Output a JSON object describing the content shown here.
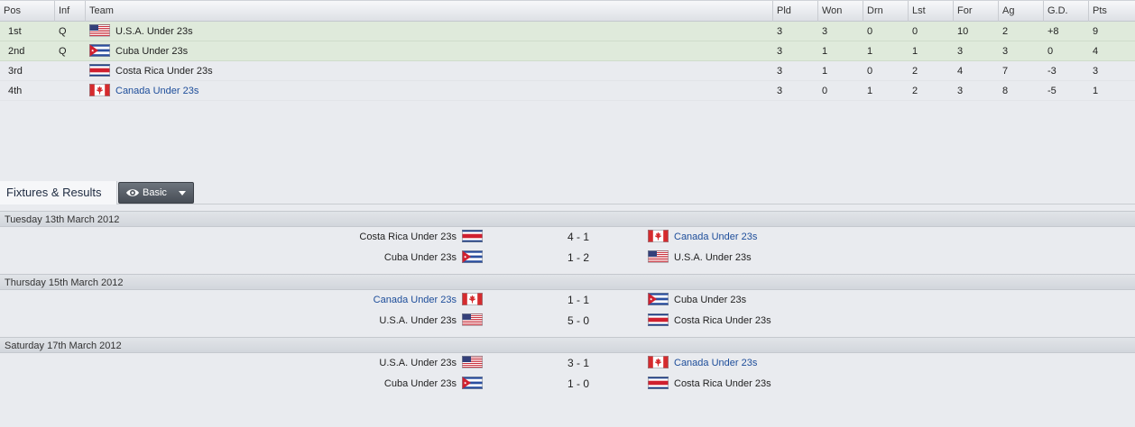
{
  "table": {
    "columns": [
      "Pos",
      "Inf",
      "Team",
      "Pld",
      "Won",
      "Drn",
      "Lst",
      "For",
      "Ag",
      "G.D.",
      "Pts"
    ],
    "rows": [
      {
        "pos": "1st",
        "inf": "Q",
        "flag": "usa-flag",
        "team": "U.S.A. Under 23s",
        "pld": "3",
        "won": "3",
        "drn": "0",
        "lst": "0",
        "for": "10",
        "ag": "2",
        "gd": "+8",
        "pts": "9",
        "qualified": true,
        "link": false
      },
      {
        "pos": "2nd",
        "inf": "Q",
        "flag": "cuba-flag",
        "team": "Cuba Under 23s",
        "pld": "3",
        "won": "1",
        "drn": "1",
        "lst": "1",
        "for": "3",
        "ag": "3",
        "gd": "0",
        "pts": "4",
        "qualified": true,
        "link": false
      },
      {
        "pos": "3rd",
        "inf": "",
        "flag": "costa-rica-flag",
        "team": "Costa Rica Under 23s",
        "pld": "3",
        "won": "1",
        "drn": "0",
        "lst": "2",
        "for": "4",
        "ag": "7",
        "gd": "-3",
        "pts": "3",
        "qualified": false,
        "link": false
      },
      {
        "pos": "4th",
        "inf": "",
        "flag": "canada-flag",
        "team": "Canada Under 23s",
        "pld": "3",
        "won": "0",
        "drn": "1",
        "lst": "2",
        "for": "3",
        "ag": "8",
        "gd": "-5",
        "pts": "1",
        "qualified": false,
        "link": true
      }
    ]
  },
  "fixtures": {
    "tab_label": "Fixtures & Results",
    "view_button": "Basic",
    "days": [
      {
        "date": "Tuesday 13th March 2012",
        "matches": [
          {
            "home": "Costa Rica Under 23s",
            "home_flag": "costa-rica-flag",
            "home_link": false,
            "score": "4 - 1",
            "away": "Canada Under 23s",
            "away_flag": "canada-flag",
            "away_link": true
          },
          {
            "home": "Cuba Under 23s",
            "home_flag": "cuba-flag",
            "home_link": false,
            "score": "1 - 2",
            "away": "U.S.A. Under 23s",
            "away_flag": "usa-flag",
            "away_link": false
          }
        ]
      },
      {
        "date": "Thursday 15th March 2012",
        "matches": [
          {
            "home": "Canada Under 23s",
            "home_flag": "canada-flag",
            "home_link": true,
            "score": "1 - 1",
            "away": "Cuba Under 23s",
            "away_flag": "cuba-flag",
            "away_link": false
          },
          {
            "home": "U.S.A. Under 23s",
            "home_flag": "usa-flag",
            "home_link": false,
            "score": "5 - 0",
            "away": "Costa Rica Under 23s",
            "away_flag": "costa-rica-flag",
            "away_link": false
          }
        ]
      },
      {
        "date": "Saturday 17th March 2012",
        "matches": [
          {
            "home": "U.S.A. Under 23s",
            "home_flag": "usa-flag",
            "home_link": false,
            "score": "3 - 1",
            "away": "Canada Under 23s",
            "away_flag": "canada-flag",
            "away_link": true
          },
          {
            "home": "Cuba Under 23s",
            "home_flag": "cuba-flag",
            "home_link": false,
            "score": "1 - 0",
            "away": "Costa Rica Under 23s",
            "away_flag": "costa-rica-flag",
            "away_link": false
          }
        ]
      }
    ]
  },
  "colors": {
    "qualified_row": "#dfeadb",
    "link_text": "#1d4d9a",
    "background": "#e9ebef"
  }
}
